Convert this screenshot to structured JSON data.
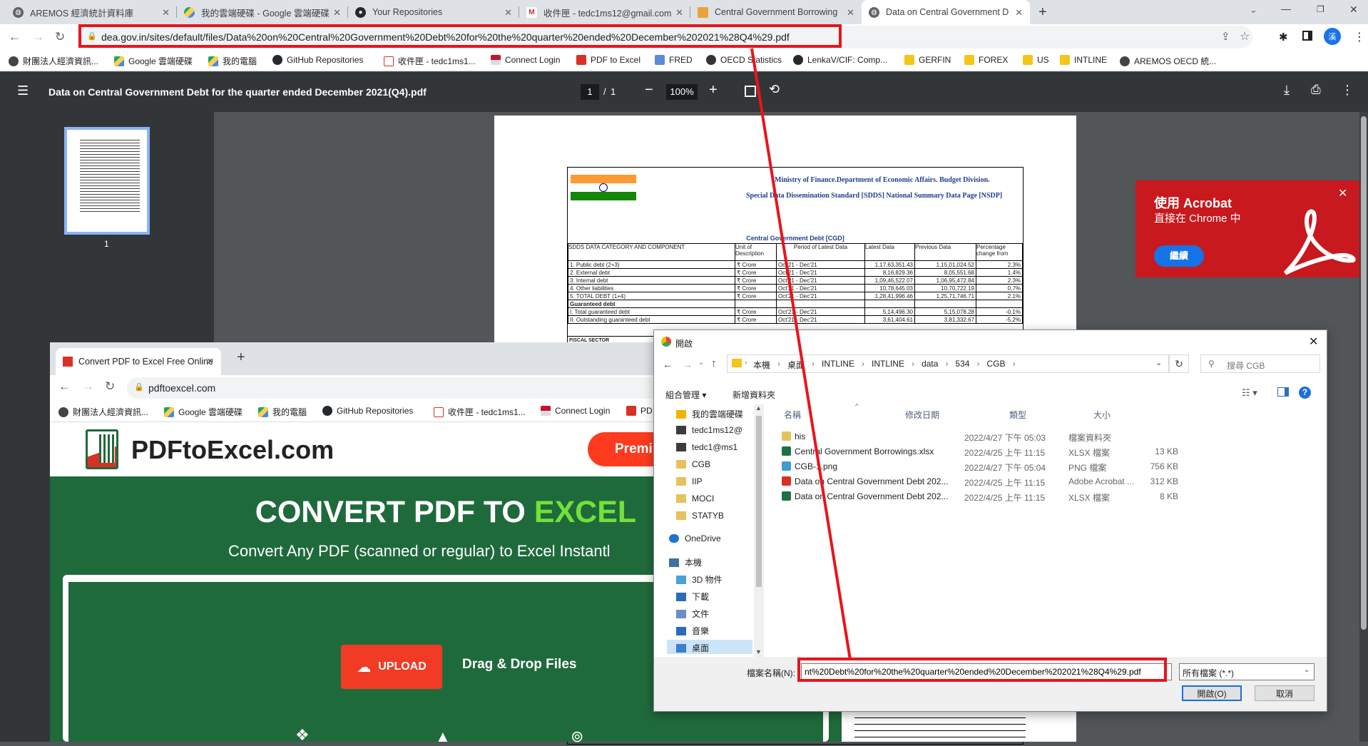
{
  "browser": {
    "tabs": [
      {
        "title": "AREMOS 經濟統計資料庫"
      },
      {
        "title": "我的雲端硬碟 - Google 雲端硬碟"
      },
      {
        "title": "Your Repositories"
      },
      {
        "title": "收件匣 - tedc1ms12@gmail.com"
      },
      {
        "title": "Central Government Borrowing"
      },
      {
        "title": "Data on Central Government D"
      }
    ],
    "url": "dea.gov.in/sites/default/files/Data%20on%20Central%20Government%20Debt%20for%20the%20quarter%20ended%20December%202021%28Q4%29.pdf",
    "profile_initial": "溪",
    "bookmarks": [
      "財團法人經濟資訊...",
      "Google 雲端硬碟",
      "我的電腦",
      "GitHub Repositories",
      "收件匣 - tedc1ms1...",
      "Connect Login",
      "PDF to Excel",
      "FRED",
      "OECD Statistics",
      "LenkaV/CIF: Comp...",
      "GERFIN",
      "FOREX",
      "US",
      "INTLINE",
      "AREMOS OECD 統..."
    ]
  },
  "pdf_viewer": {
    "title": "Data on Central Government Debt for the quarter ended December 2021(Q4).pdf",
    "page_current": "1",
    "page_sep": "/",
    "page_total": "1",
    "zoom": "100%",
    "thumb_label": "1"
  },
  "document": {
    "ministry": "Ministry of Finance.Department of Economic Affairs. Budget Division.",
    "subtitle": "Special Data Dissemination Standard [SDDS] National Summary Data Page [NSDP]",
    "table_title": "Central Government Debt [CGD]",
    "headers": [
      "SDDS DATA CATEGORY AND COMPONENT",
      "Unit of Description",
      "Period of Latest Data",
      "Latest Data",
      "Previous Data",
      "Percentage change from"
    ],
    "rows": [
      [
        "1. Public debt (2+3)",
        "₹ Crore",
        "Oct'21 - Dec'21",
        "1,17,63,351.43",
        "1,15,01,024.52",
        "2.3%"
      ],
      [
        "2. External debt",
        "₹ Crore",
        "Oct'21 - Dec'21",
        "8,16,829.36",
        "8,05,551.68",
        "1.4%"
      ],
      [
        "3. Internal debt",
        "₹ Crore",
        "Oct'21 - Dec'21",
        "1,09,46,522.07",
        "1,06,95,472.84",
        "2.3%"
      ],
      [
        "4. Other liabilities",
        "₹ Crore",
        "Oct'21 - Dec'21",
        "10,78,645.03",
        "10,70,722.19",
        "0.7%"
      ],
      [
        "5. TOTAL DEBT (1+4)",
        "₹ Crore",
        "Oct'21 - Dec'21",
        "1,28,41,996.46",
        "1,25,71,746.71",
        "2.1%"
      ],
      [
        "Guaranteed debt",
        "",
        "",
        "",
        "",
        ""
      ],
      [
        "I. Total guaranteed debt",
        "₹ Crore",
        "Oct'21 - Dec'21",
        "5,14,496.30",
        "5,15,078.28",
        "-0.1%"
      ],
      [
        "II. Outstanding guaranteed debt",
        "₹ Crore",
        "Oct'21 - Dec'21",
        "3,61,404.61",
        "3,81,332.67",
        "-5.2%"
      ]
    ],
    "fiscal_label": "FISCAL SECTOR"
  },
  "acrobat_popup": {
    "title": "使用 Acrobat",
    "subtitle": "直接在 Chrome 中",
    "button": "繼續",
    "color": "#c8191e"
  },
  "second_window": {
    "tab_title": "Convert PDF to Excel Free Online",
    "url": "pdftoexcel.com",
    "bookmarks": [
      "財團法人經濟資訊...",
      "Google 雲端硬碟",
      "我的電腦",
      "GitHub Repositories",
      "收件匣 - tedc1ms1...",
      "Connect Login",
      "PD"
    ],
    "logo_text": "PDFtoExcel.com",
    "premium_btn": "Premi",
    "hero_prefix": "CONVERT PDF TO ",
    "hero_accent": "EXCEL",
    "hero_sub": "Convert Any PDF (scanned or regular) to Excel Instantl",
    "upload_btn": "UPLOAD",
    "drag_text": "Drag & Drop Files",
    "bg_color": "#1f6a3b",
    "accent_color": "#74e03b"
  },
  "dialog": {
    "title": "開啟",
    "breadcrumb": [
      "本機",
      "桌面",
      "INTLINE",
      "INTLINE",
      "data",
      "534",
      "CGB"
    ],
    "search_placeholder": "搜尋 CGB",
    "organize": "組合管理 ▾",
    "new_folder": "新增資料夾",
    "nav": [
      {
        "label": "我的雲端硬碟",
        "icon": "drive-icon"
      },
      {
        "label": "tedc1ms12@",
        "icon": "account-icon"
      },
      {
        "label": "tedc1@ms1",
        "icon": "account-icon"
      },
      {
        "label": "CGB",
        "icon": "folder-icon"
      },
      {
        "label": "IIP",
        "icon": "folder-icon"
      },
      {
        "label": "MOCI",
        "icon": "folder-icon"
      },
      {
        "label": "STATYB",
        "icon": "folder-icon"
      },
      {
        "label": "OneDrive",
        "icon": "cloud-icon"
      },
      {
        "label": "本機",
        "icon": "pc-icon"
      },
      {
        "label": "3D 物件",
        "icon": "cube-icon"
      },
      {
        "label": "下載",
        "icon": "download-icon"
      },
      {
        "label": "文件",
        "icon": "document-icon"
      },
      {
        "label": "音樂",
        "icon": "music-icon"
      },
      {
        "label": "桌面",
        "icon": "desktop-icon"
      }
    ],
    "columns": [
      "名稱",
      "修改日期",
      "類型",
      "大小"
    ],
    "files": [
      {
        "name": "his",
        "date": "2022/4/27 下午 05:03",
        "type": "檔案資料夾",
        "size": ""
      },
      {
        "name": "Central Government Borrowings.xlsx",
        "date": "2022/4/25 上午 11:15",
        "type": "XLSX 檔案",
        "size": "13 KB"
      },
      {
        "name": "CGB-1.png",
        "date": "2022/4/27 下午 05:04",
        "type": "PNG 檔案",
        "size": "756 KB"
      },
      {
        "name": "Data on Central Government Debt 202...",
        "date": "2022/4/25 上午 11:15",
        "type": "Adobe Acrobat ...",
        "size": "312 KB"
      },
      {
        "name": "Data on Central Government Debt 202...",
        "date": "2022/4/25 上午 11:15",
        "type": "XLSX 檔案",
        "size": "8 KB"
      }
    ],
    "filename_label": "檔案名稱(N):",
    "filename_value": "nt%20Debt%20for%20the%20quarter%20ended%20December%202021%28Q4%29.pdf",
    "filter": "所有檔案 (*.*)",
    "open_btn": "開啟(O)",
    "cancel_btn": "取消"
  },
  "colors": {
    "highlight_red": "#e8141c"
  }
}
